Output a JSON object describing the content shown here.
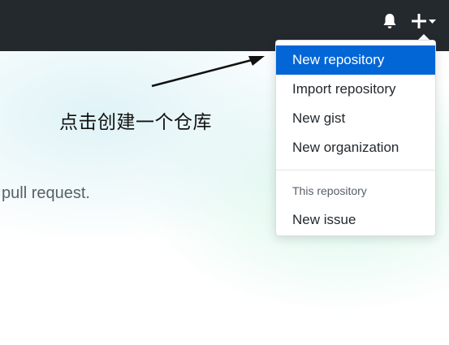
{
  "annotation": {
    "text": "点击创建一个仓库"
  },
  "page": {
    "partial_text": "pull request."
  },
  "header": {
    "icons": [
      "bell-icon",
      "plus-icon",
      "caret-down-icon"
    ]
  },
  "dropdown": {
    "items": [
      {
        "label": "New repository",
        "active": true
      },
      {
        "label": "Import repository",
        "active": false
      },
      {
        "label": "New gist",
        "active": false
      },
      {
        "label": "New organization",
        "active": false
      }
    ],
    "section_header": "This repository",
    "section_items": [
      {
        "label": "New issue"
      }
    ]
  },
  "colors": {
    "header_bg": "#24292e",
    "active_item_bg": "#0366d6",
    "muted_text": "#586069"
  }
}
